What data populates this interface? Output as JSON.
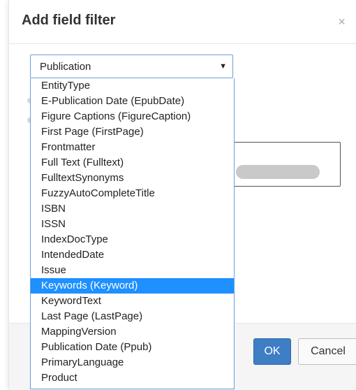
{
  "dialog": {
    "title": "Add field filter",
    "close_glyph": "×"
  },
  "select": {
    "value": "Publication",
    "arrow_glyph": "▼"
  },
  "options": [
    "EntityType",
    "E-Publication Date (EpubDate)",
    "Figure Captions (FigureCaption)",
    "First Page (FirstPage)",
    "Frontmatter",
    "Full Text (Fulltext)",
    "FulltextSynonyms",
    "FuzzyAutoCompleteTitle",
    "ISBN",
    "ISSN",
    "IndexDocType",
    "IntendedDate",
    "Issue",
    "Keywords (Keyword)",
    "KeywordText",
    "Last Page (LastPage)",
    "MappingVersion",
    "Publication Date (Ppub)",
    "PrimaryLanguage",
    "Product"
  ],
  "highlighted_option": "Keywords (Keyword)",
  "buttons": {
    "ok": "OK",
    "cancel": "Cancel"
  },
  "colors": {
    "highlight": "#1e90ff",
    "primary_button": "#3e7ec4",
    "select_border": "#6a9fd8"
  }
}
